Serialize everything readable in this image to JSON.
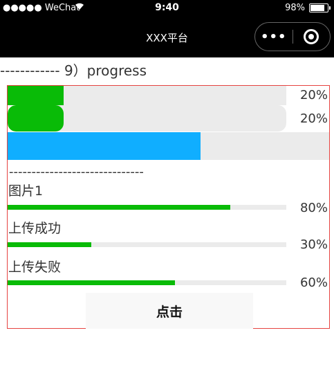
{
  "status_bar": {
    "carrier": "●●●●● WeChat",
    "time": "9:40",
    "battery": "98%"
  },
  "nav": {
    "title": "XXX平台",
    "more_icon": "ellipsis-icon",
    "close_icon": "target-close-icon"
  },
  "section_title": "------------ 9）progress",
  "progress": [
    {
      "percent_label": "20%",
      "value": 0.2,
      "color": "#09bb07",
      "style": "square"
    },
    {
      "percent_label": "20%",
      "value": 0.2,
      "color": "#09bb07",
      "style": "rounded"
    },
    {
      "value": 0.6,
      "color": "#10aeff",
      "style": "thick"
    }
  ],
  "divider": "------------------------------",
  "uploads": [
    {
      "label": "图片1",
      "percent_label": "80%",
      "value": 0.8
    },
    {
      "label": "上传成功",
      "percent_label": "30%",
      "value": 0.3
    },
    {
      "label": "上传失败",
      "percent_label": "60%",
      "value": 0.6
    }
  ],
  "colors": {
    "accent_green": "#09bb07",
    "accent_blue": "#10aeff",
    "track": "#ebebeb",
    "border": "#e64340"
  },
  "button": {
    "label": "点击"
  }
}
